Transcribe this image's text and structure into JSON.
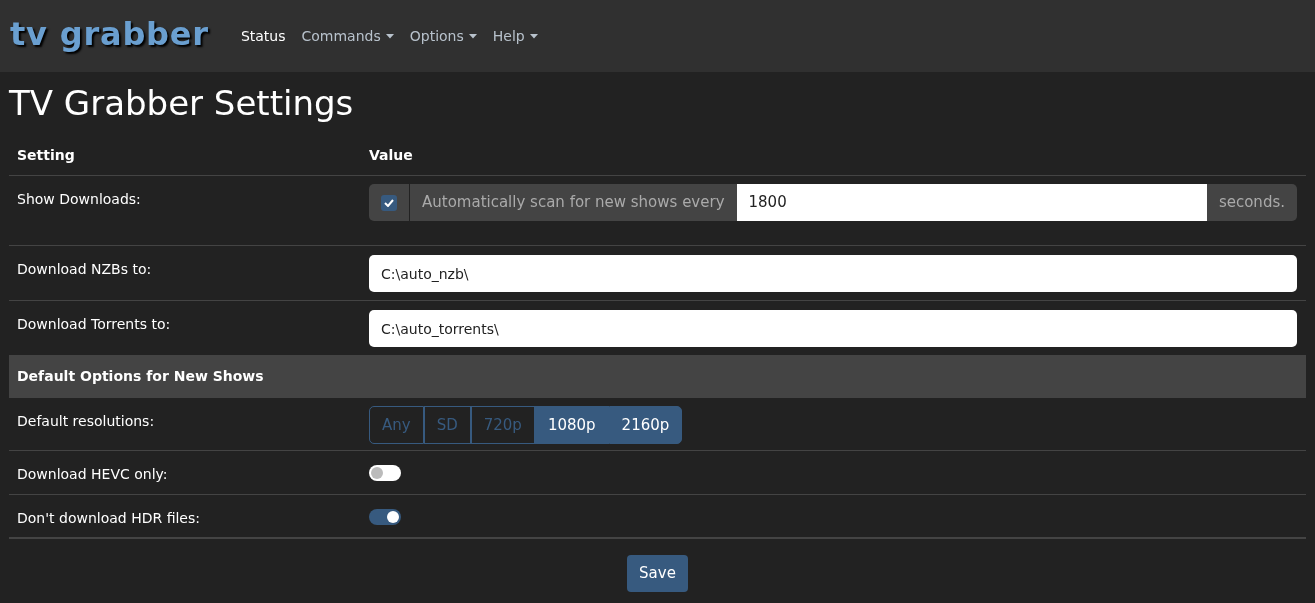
{
  "navbar": {
    "logo": "tv grabber",
    "items": [
      {
        "label": "Status",
        "selected": true,
        "dropdown": false
      },
      {
        "label": "Commands",
        "selected": false,
        "dropdown": true
      },
      {
        "label": "Options",
        "selected": false,
        "dropdown": true
      },
      {
        "label": "Help",
        "selected": false,
        "dropdown": true
      }
    ]
  },
  "page_title": "TV Grabber Settings",
  "table": {
    "columns": [
      "Setting",
      "Value"
    ],
    "rows": [
      {
        "kind": "scan",
        "label": "Show Downloads:",
        "checked": true,
        "prefix": "Automatically scan for new shows every",
        "value": "1800",
        "suffix": "seconds."
      },
      {
        "kind": "text",
        "label": "Download NZBs to:",
        "value": "C:\\auto_nzb\\"
      },
      {
        "kind": "text",
        "label": "Download Torrents to:",
        "value": "C:\\auto_torrents\\"
      },
      {
        "kind": "section",
        "label": "Default Options for New Shows"
      },
      {
        "kind": "choices",
        "label": "Default resolutions:",
        "options": [
          {
            "label": "Any",
            "selected": false
          },
          {
            "label": "SD",
            "selected": false
          },
          {
            "label": "720p",
            "selected": false
          },
          {
            "label": "1080p",
            "selected": true
          },
          {
            "label": "2160p",
            "selected": true
          }
        ]
      },
      {
        "kind": "switch",
        "label": "Download HEVC only:",
        "on": false
      },
      {
        "kind": "switch",
        "label": "Don't download HDR files:",
        "on": true
      }
    ]
  },
  "save_button": "Save"
}
